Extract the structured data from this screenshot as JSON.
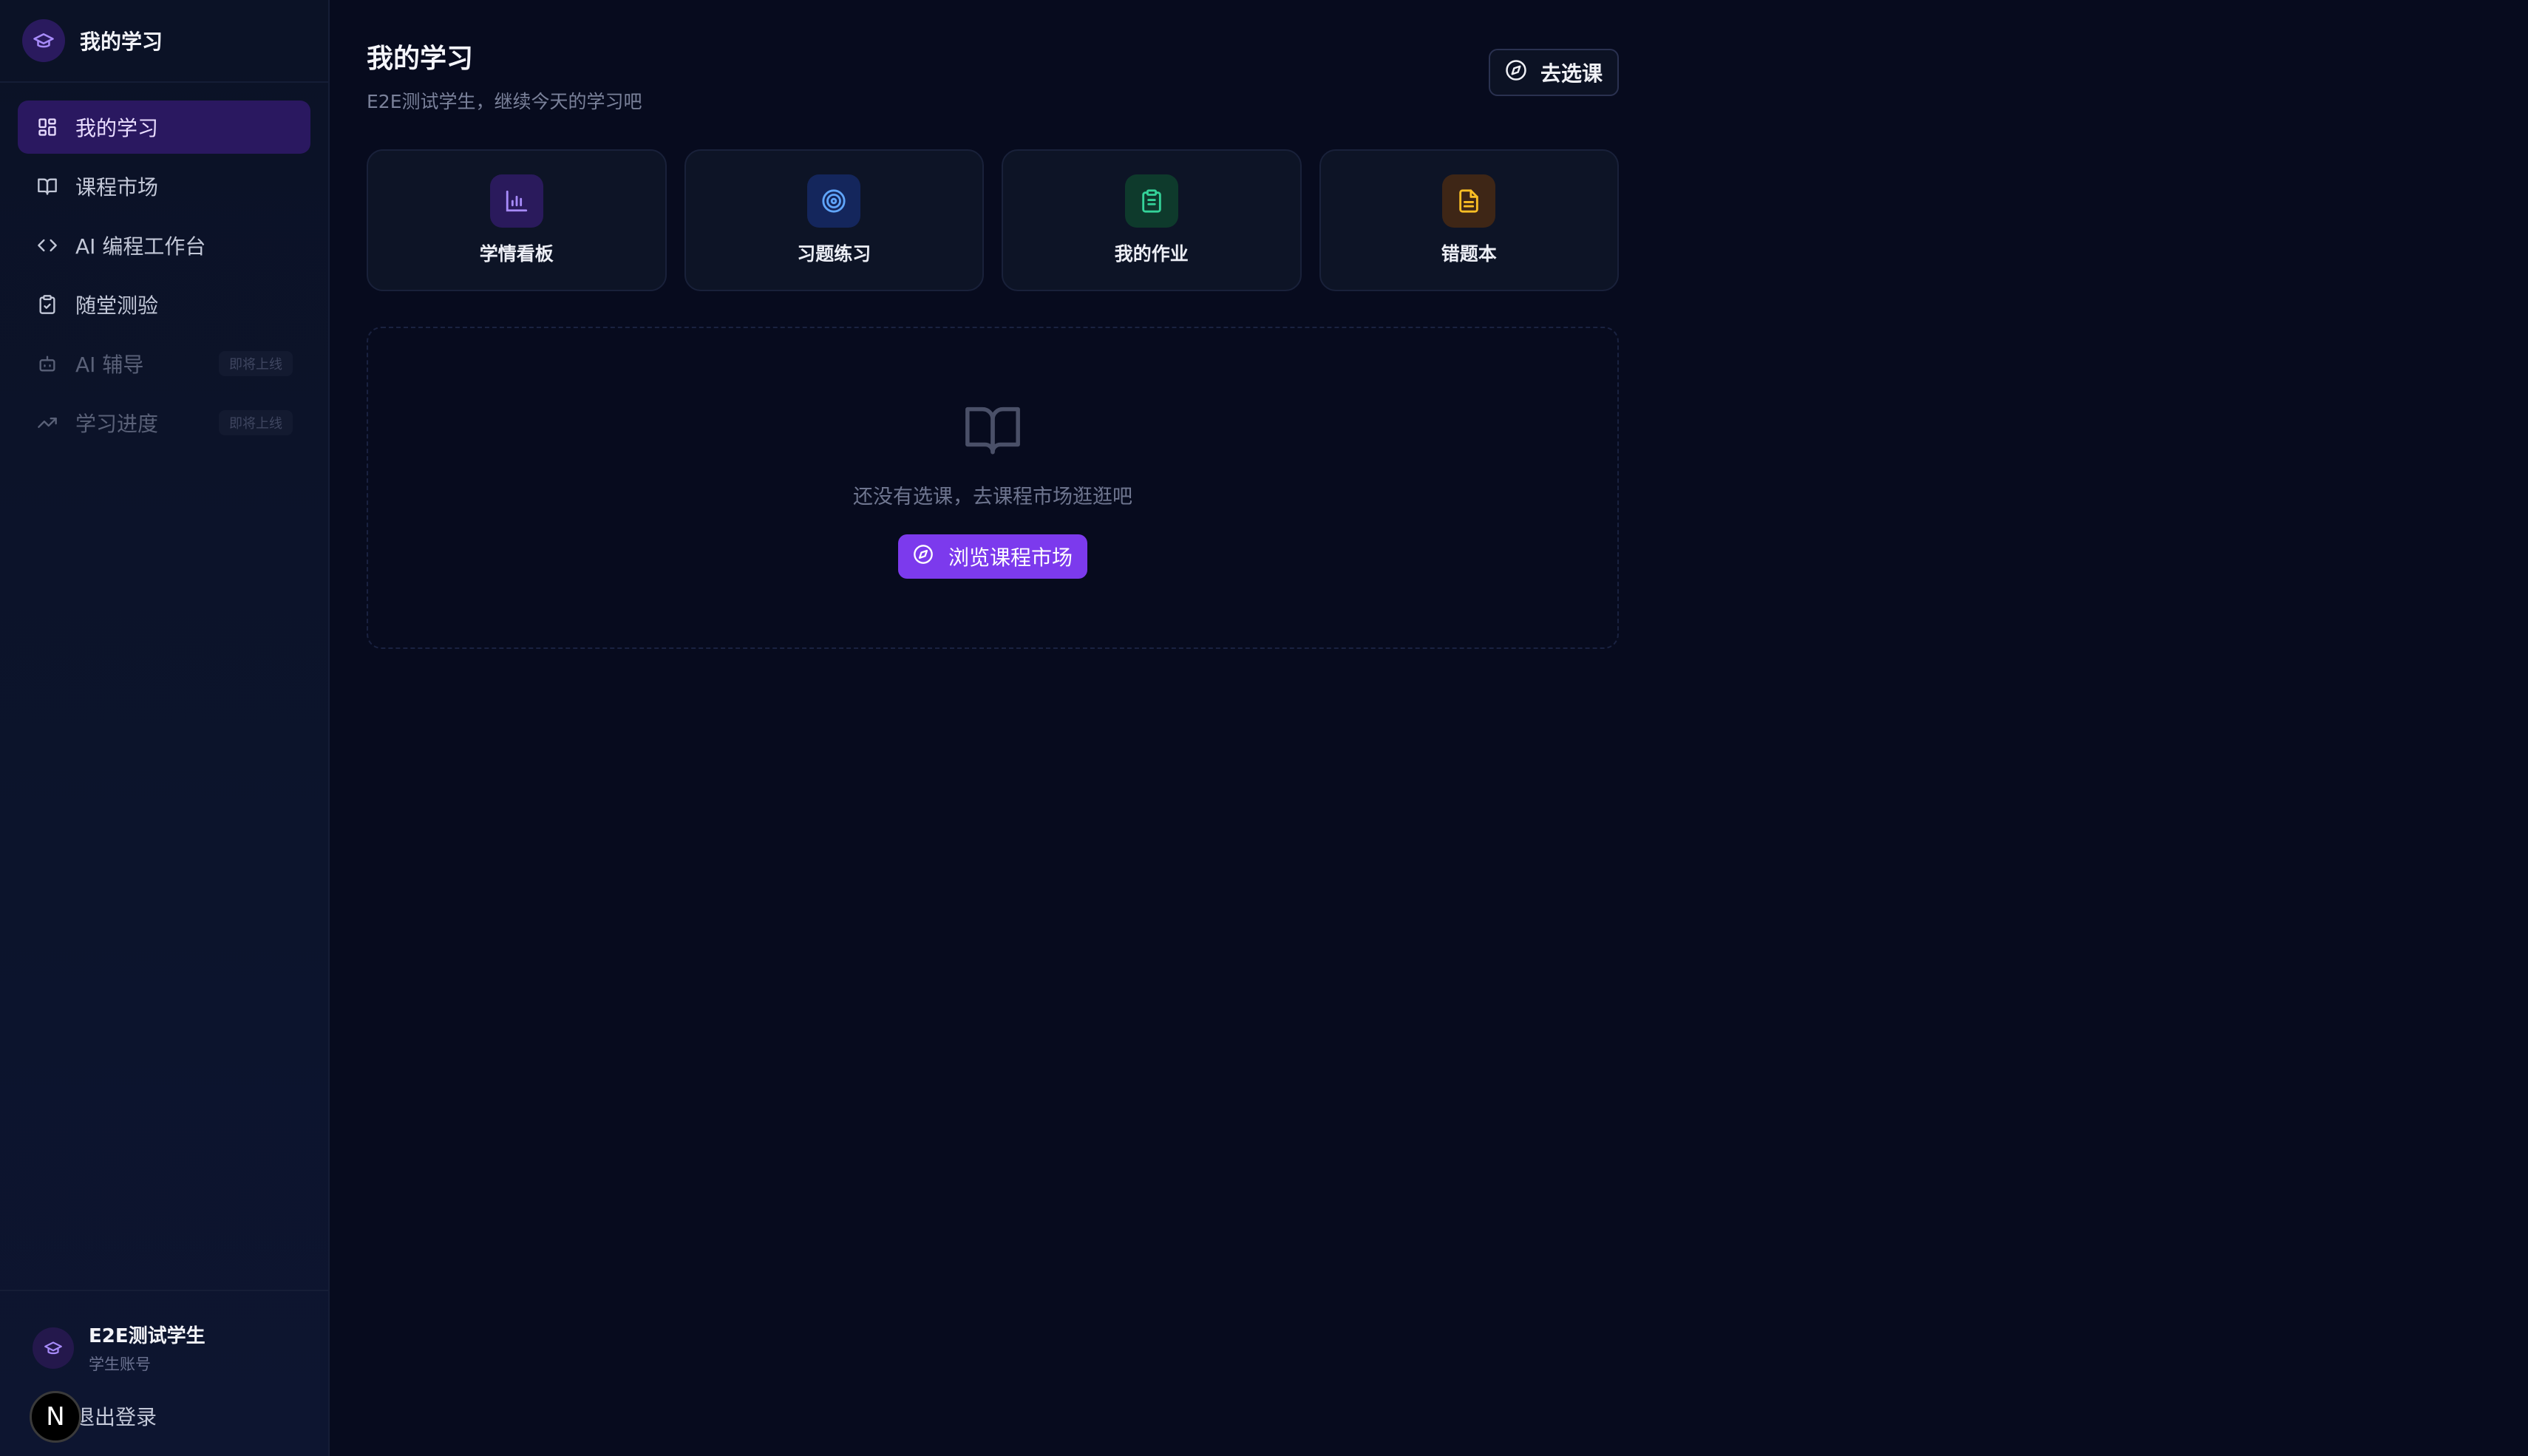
{
  "brand": {
    "title": "我的学习",
    "icon": "graduation-cap-icon"
  },
  "sidebar": {
    "items": [
      {
        "label": "我的学习",
        "icon": "dashboard-icon",
        "active": true
      },
      {
        "label": "课程市场",
        "icon": "book-open-icon"
      },
      {
        "label": "AI 编程工作台",
        "icon": "code-icon"
      },
      {
        "label": "随堂测验",
        "icon": "clipboard-check-icon"
      },
      {
        "label": "AI 辅导",
        "icon": "bot-icon",
        "disabled": true,
        "badge": "即将上线"
      },
      {
        "label": "学习进度",
        "icon": "trending-up-icon",
        "disabled": true,
        "badge": "即将上线"
      }
    ]
  },
  "user": {
    "name": "E2E测试学生",
    "role": "学生账号",
    "logout": "退出登录",
    "badge": "N"
  },
  "header": {
    "title": "我的学习",
    "subtitle": "E2E测试学生，继续今天的学习吧",
    "browse_button": "去选课"
  },
  "cards": [
    {
      "label": "学情看板",
      "icon": "bar-chart-icon",
      "color": "#a78bfa",
      "bg": "#2a1a5c"
    },
    {
      "label": "习题练习",
      "icon": "target-icon",
      "color": "#60a5fa",
      "bg": "#14265c"
    },
    {
      "label": "我的作业",
      "icon": "clipboard-list-icon",
      "color": "#34d399",
      "bg": "#0e3a2c"
    },
    {
      "label": "错题本",
      "icon": "file-text-icon",
      "color": "#fbbf24",
      "bg": "#3e2616"
    }
  ],
  "empty_state": {
    "text": "还没有选课，去课程市场逛逛吧",
    "button": "浏览课程市场"
  },
  "colors": {
    "accent": "#7c3aed",
    "background": "#070b1e",
    "sidebar": "#0b1226"
  }
}
